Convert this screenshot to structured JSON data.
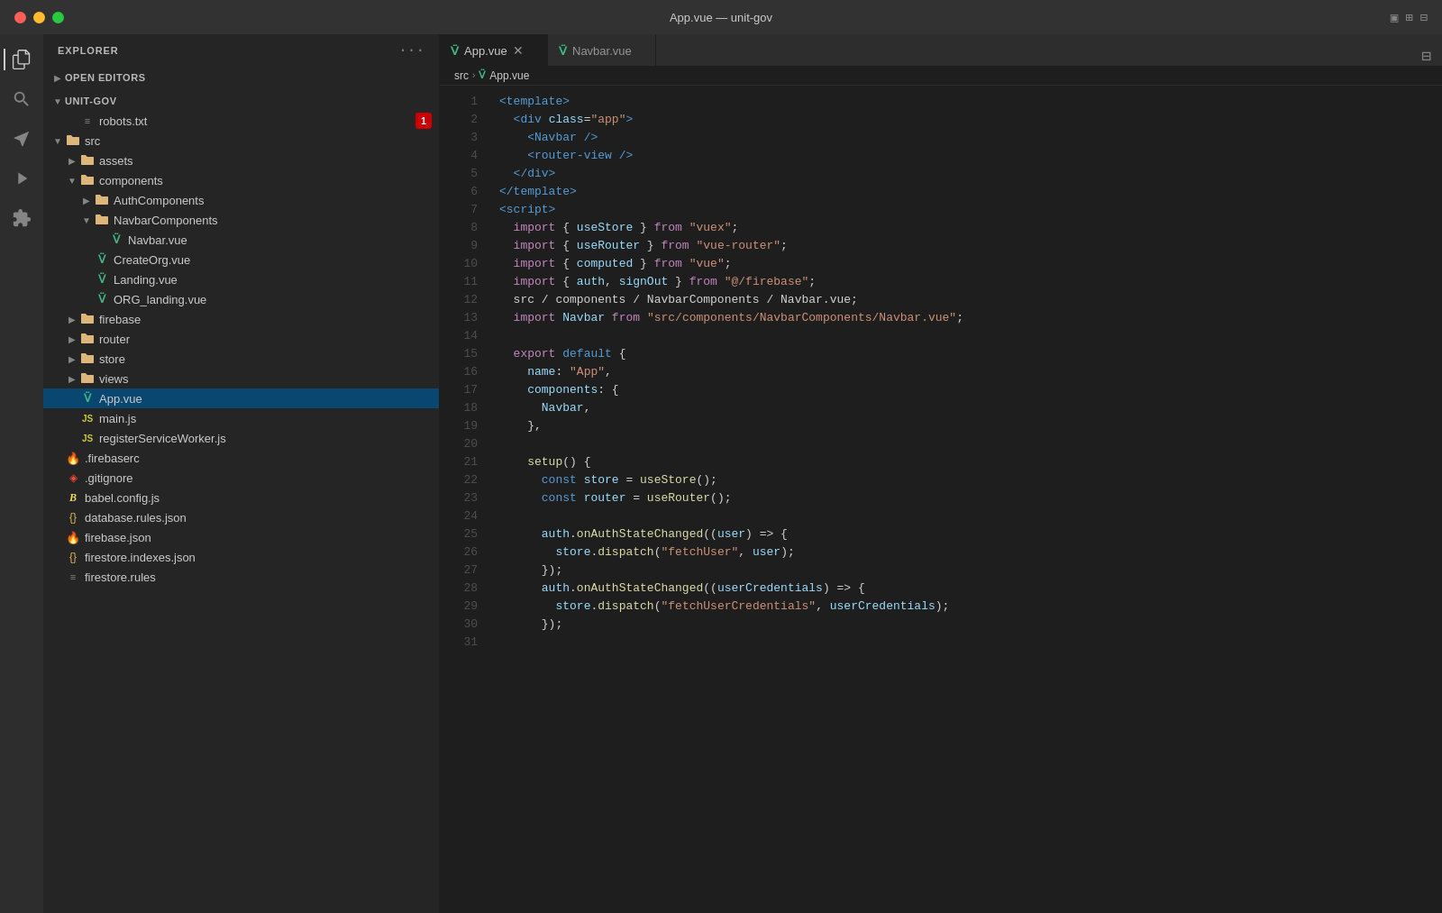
{
  "titlebar": {
    "title": "App.vue — unit-gov",
    "buttons": [
      "close",
      "minimize",
      "maximize"
    ]
  },
  "activity_bar": {
    "icons": [
      "explorer",
      "search",
      "source-control",
      "run",
      "extensions"
    ]
  },
  "sidebar": {
    "title": "EXPLORER",
    "sections": {
      "open_editors": {
        "label": "OPEN EDITORS",
        "collapsed": true
      },
      "project": {
        "label": "UNIT-GOV",
        "items": [
          {
            "name": "robots.txt",
            "icon": "txt",
            "indent": 1,
            "badge": "1"
          },
          {
            "name": "src",
            "icon": "folder",
            "indent": 1,
            "expanded": true
          },
          {
            "name": "assets",
            "icon": "folder",
            "indent": 2,
            "expanded": false
          },
          {
            "name": "components",
            "icon": "folder",
            "indent": 2,
            "expanded": true
          },
          {
            "name": "AuthComponents",
            "icon": "folder",
            "indent": 3,
            "expanded": false
          },
          {
            "name": "NavbarComponents",
            "icon": "folder",
            "indent": 3,
            "expanded": true
          },
          {
            "name": "Navbar.vue",
            "icon": "vue",
            "indent": 4
          },
          {
            "name": "CreateOrg.vue",
            "icon": "vue",
            "indent": 3
          },
          {
            "name": "Landing.vue",
            "icon": "vue",
            "indent": 3
          },
          {
            "name": "ORG_landing.vue",
            "icon": "vue",
            "indent": 3
          },
          {
            "name": "firebase",
            "icon": "folder",
            "indent": 2,
            "expanded": false
          },
          {
            "name": "router",
            "icon": "folder",
            "indent": 2,
            "expanded": false
          },
          {
            "name": "store",
            "icon": "folder",
            "indent": 2,
            "expanded": false
          },
          {
            "name": "views",
            "icon": "folder",
            "indent": 2,
            "expanded": false
          },
          {
            "name": "App.vue",
            "icon": "vue",
            "indent": 2,
            "active": true
          },
          {
            "name": "main.js",
            "icon": "js",
            "indent": 2
          },
          {
            "name": "registerServiceWorker.js",
            "icon": "js",
            "indent": 2
          },
          {
            "name": ".firebaserc",
            "icon": "fire",
            "indent": 1
          },
          {
            "name": ".gitignore",
            "icon": "git",
            "indent": 1
          },
          {
            "name": "babel.config.js",
            "icon": "babel",
            "indent": 1
          },
          {
            "name": "database.rules.json",
            "icon": "json",
            "indent": 1
          },
          {
            "name": "firebase.json",
            "icon": "fire",
            "indent": 1
          },
          {
            "name": "firestore.indexes.json",
            "icon": "json",
            "indent": 1
          },
          {
            "name": "firestore.rules",
            "icon": "rules",
            "indent": 1
          }
        ]
      }
    }
  },
  "tabs": [
    {
      "label": "App.vue",
      "icon": "vue",
      "active": true,
      "closable": true
    },
    {
      "label": "Navbar.vue",
      "icon": "vue",
      "active": false,
      "closable": false
    }
  ],
  "breadcrumb": {
    "parts": [
      "src",
      "App.vue"
    ]
  },
  "code": {
    "lines": [
      {
        "num": 1,
        "content": "<template>"
      },
      {
        "num": 2,
        "content": "  <div class=\"app\">"
      },
      {
        "num": 3,
        "content": "    <Navbar />"
      },
      {
        "num": 4,
        "content": "    <router-view />"
      },
      {
        "num": 5,
        "content": "  </div>"
      },
      {
        "num": 6,
        "content": "</template>"
      },
      {
        "num": 7,
        "content": "<script>"
      },
      {
        "num": 8,
        "content": "  import { useStore } from \"vuex\";"
      },
      {
        "num": 9,
        "content": "  import { useRouter } from \"vue-router\";"
      },
      {
        "num": 10,
        "content": "  import { computed } from \"vue\";"
      },
      {
        "num": 11,
        "content": "  import { auth, signOut } from \"@/firebase\";"
      },
      {
        "num": 12,
        "content": "  src / components / NavbarComponents / Navbar.vue;"
      },
      {
        "num": 13,
        "content": "  import Navbar from \"src/components/NavbarComponents/Navbar.vue\";"
      },
      {
        "num": 14,
        "content": ""
      },
      {
        "num": 15,
        "content": "  export default {"
      },
      {
        "num": 16,
        "content": "    name: \"App\","
      },
      {
        "num": 17,
        "content": "    components: {"
      },
      {
        "num": 18,
        "content": "      Navbar,"
      },
      {
        "num": 19,
        "content": "    },"
      },
      {
        "num": 20,
        "content": ""
      },
      {
        "num": 21,
        "content": "    setup() {"
      },
      {
        "num": 22,
        "content": "      const store = useStore();"
      },
      {
        "num": 23,
        "content": "      const router = useRouter();"
      },
      {
        "num": 24,
        "content": ""
      },
      {
        "num": 25,
        "content": "      auth.onAuthStateChanged((user) => {"
      },
      {
        "num": 26,
        "content": "        store.dispatch(\"fetchUser\", user);"
      },
      {
        "num": 27,
        "content": "      });"
      },
      {
        "num": 28,
        "content": "      auth.onAuthStateChanged((userCredentials) => {"
      },
      {
        "num": 29,
        "content": "        store.dispatch(\"fetchUserCredentials\", userCredentials);"
      },
      {
        "num": 30,
        "content": "      });"
      },
      {
        "num": 31,
        "content": ""
      }
    ]
  }
}
